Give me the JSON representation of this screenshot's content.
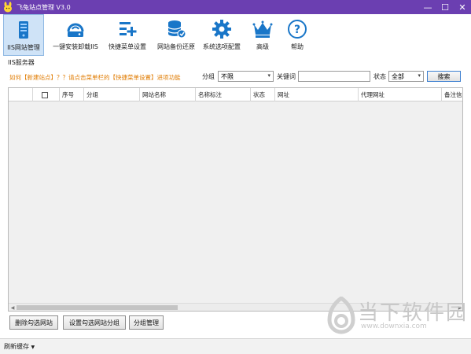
{
  "window": {
    "title": "飞兔站点管理 V3.0",
    "controls": {
      "minimize": "—",
      "maximize": "☐",
      "close": "✕"
    }
  },
  "toolbar": {
    "items": [
      {
        "label": "IIS网站管理",
        "icon": "server-icon"
      },
      {
        "label": "一键安装卸载IIS",
        "icon": "disk-icon"
      },
      {
        "label": "快捷菜单设置",
        "icon": "menu-plus-icon"
      },
      {
        "label": "网站备份还原",
        "icon": "database-icon"
      },
      {
        "label": "系统选项配置",
        "icon": "gear-icon"
      },
      {
        "label": "高级",
        "icon": "crown-icon"
      },
      {
        "label": "帮助",
        "icon": "help-icon"
      }
    ]
  },
  "section": {
    "label": "IIS服务器"
  },
  "hint": {
    "text": "如何【新建站点】？？请点击菜单栏的【快捷菜单设置】进项功能"
  },
  "filters": {
    "group_label": "分组",
    "group_value": "不限",
    "keyword_label": "关键词",
    "keyword_value": "",
    "status_label": "状态",
    "status_value": "全部",
    "search_button": "搜索"
  },
  "table": {
    "columns": [
      "序号",
      "分组",
      "网站名称",
      "名称标注",
      "状态",
      "网址",
      "代理网址",
      "备注信息"
    ]
  },
  "actions": {
    "delete_checked": "删除勾选网站",
    "set_group": "设置勾选网站分组",
    "group_manage": "分组管理"
  },
  "status": {
    "refresh_cache": "刷新缓存"
  },
  "watermark": {
    "text": "当下软件园",
    "url": "www.downxia.com"
  },
  "colors": {
    "titlebar": "#6b3fb1",
    "hint": "#e07b00",
    "accent": "#1976c8"
  }
}
